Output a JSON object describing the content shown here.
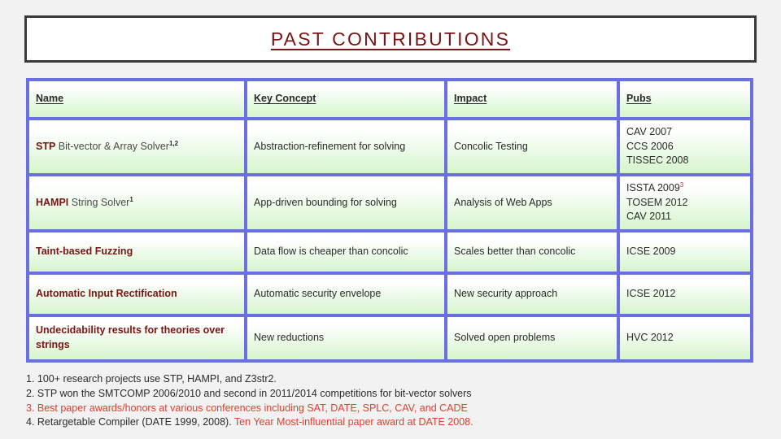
{
  "slide": {
    "title": "PAST CONTRIBUTIONS",
    "accent_title_color": "#7b1414",
    "table_border_color": "#6b6fe0",
    "header_text_color": "#1a1ad0",
    "cell_bg_top": "#ffffff",
    "cell_bg_bottom": "#d6f5cd",
    "footnote_red": "#e0402f"
  },
  "table": {
    "headers": {
      "name": "Name",
      "key_concept": "Key Concept",
      "impact": "Impact",
      "pubs": "Pubs"
    },
    "rows": [
      {
        "name_lead": "STP",
        "name_rest": " Bit-vector & Array Solver",
        "name_sup": "1,2",
        "key_concept": "Abstraction-refinement for solving",
        "impact": "Concolic Testing",
        "pubs": [
          "CAV 2007",
          "CCS 2006",
          "TISSEC 2008"
        ],
        "pubs_sup": ""
      },
      {
        "name_lead": "HAMPI",
        "name_rest": " String Solver",
        "name_sup": "1",
        "key_concept": "App-driven bounding for solving",
        "impact": "Analysis of  Web Apps",
        "pubs": [
          "ISSTA 2009",
          "TOSEM 2012",
          "CAV 2011"
        ],
        "pubs_sup": "3"
      },
      {
        "name_lead": "Taint-based Fuzzing",
        "name_rest": "",
        "name_sup": "",
        "key_concept": "Data flow is cheaper than concolic",
        "impact": "Scales better than concolic",
        "pubs": [
          "ICSE 2009"
        ],
        "pubs_sup": ""
      },
      {
        "name_lead": "Automatic Input Rectification",
        "name_rest": "",
        "name_sup": "",
        "key_concept": "Automatic security envelope",
        "impact": "New security approach",
        "pubs": [
          "ICSE 2012"
        ],
        "pubs_sup": ""
      },
      {
        "name_lead": "Undecidability results for theories over strings",
        "name_rest": "",
        "name_sup": "",
        "key_concept": "New reductions",
        "impact": "Solved open problems",
        "pubs": [
          "HVC 2012"
        ],
        "pubs_sup": ""
      }
    ]
  },
  "footnotes": [
    {
      "text": "1. 100+ research projects use STP, HAMPI, and Z3str2.",
      "color": "dark",
      "red_tail": ""
    },
    {
      "text": "2. STP won the SMTCOMP 2006/2010 and second in 2011/2014 competitions for bit-vector solvers",
      "color": "dark",
      "red_tail": ""
    },
    {
      "text": "3. Best paper awards/honors at various conferences including SAT, DATE, SPLC, CAV, and CADE",
      "color": "red",
      "red_tail": ""
    },
    {
      "text": "4. Retargetable Compiler (DATE 1999, 2008). ",
      "color": "dark",
      "red_tail": "Ten Year Most-influential paper award at DATE 2008."
    }
  ]
}
